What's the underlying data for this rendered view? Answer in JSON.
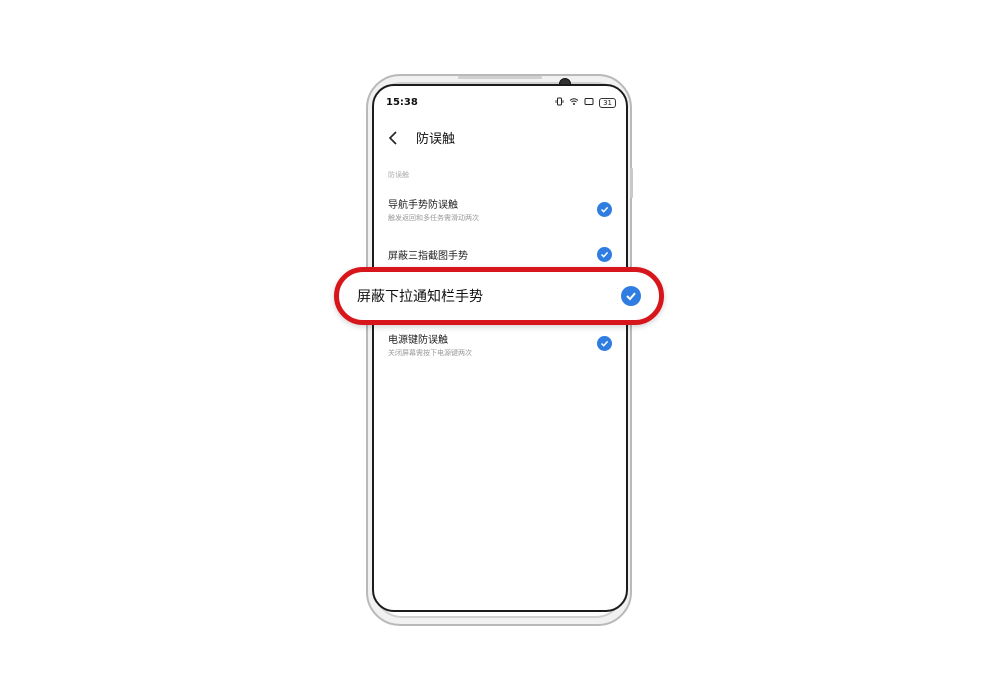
{
  "status_bar": {
    "time": "15:38",
    "icons": [
      "vibrate-icon",
      "wifi-icon",
      "screen-icon",
      "battery-icon"
    ],
    "battery_level": "31"
  },
  "header": {
    "title": "防误触",
    "back_icon": "chevron-left-icon"
  },
  "section": {
    "title": "防误触"
  },
  "settings": [
    {
      "title": "导航手势防误触",
      "subtitle": "触发返回和多任务需滑动两次",
      "checked": true
    },
    {
      "title": "屏蔽三指截图手势",
      "subtitle": "",
      "checked": true
    },
    {
      "title": "屏蔽下拉通知栏手势",
      "subtitle": "",
      "checked": true
    },
    {
      "title": "电源键防误触",
      "subtitle": "关闭屏幕需按下电源键两次",
      "checked": true
    }
  ],
  "highlight": {
    "label": "屏蔽下拉通知栏手势",
    "checked": true,
    "outline_color": "#d7161c"
  },
  "colors": {
    "accent": "#2f7de1"
  }
}
